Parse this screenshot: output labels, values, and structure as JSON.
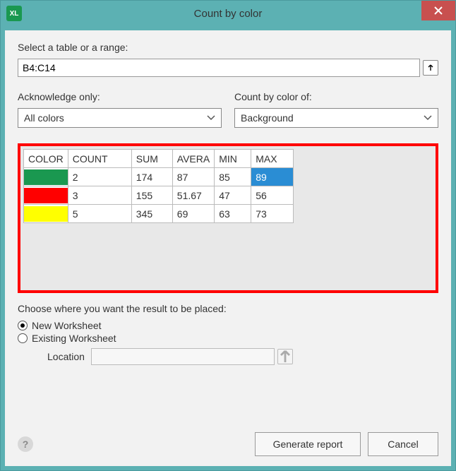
{
  "window": {
    "title": "Count by color",
    "app_icon_text": "XL"
  },
  "range": {
    "label": "Select a table or a range:",
    "value": "B4:C14"
  },
  "ack": {
    "label": "Acknowledge only:",
    "selected": "All colors"
  },
  "countby": {
    "label": "Count by color of:",
    "selected": "Background"
  },
  "table": {
    "headers": [
      "COLOR",
      "COUNT",
      "SUM",
      "AVERA",
      "MIN",
      "MAX"
    ],
    "rows": [
      {
        "color": "#1a9850",
        "count": "2",
        "sum": "174",
        "avg": "87",
        "min": "85",
        "max": "89",
        "max_selected": true
      },
      {
        "color": "#ff0000",
        "count": "3",
        "sum": "155",
        "avg": "51.67",
        "min": "47",
        "max": "56",
        "max_selected": false
      },
      {
        "color": "#ffff00",
        "count": "5",
        "sum": "345",
        "avg": "69",
        "min": "63",
        "max": "73",
        "max_selected": false
      }
    ]
  },
  "placement": {
    "label": "Choose where you want the result to be placed:",
    "option_new": "New Worksheet",
    "option_existing": "Existing Worksheet",
    "location_label": "Location",
    "location_value": ""
  },
  "buttons": {
    "generate": "Generate report",
    "cancel": "Cancel"
  },
  "help_glyph": "?"
}
